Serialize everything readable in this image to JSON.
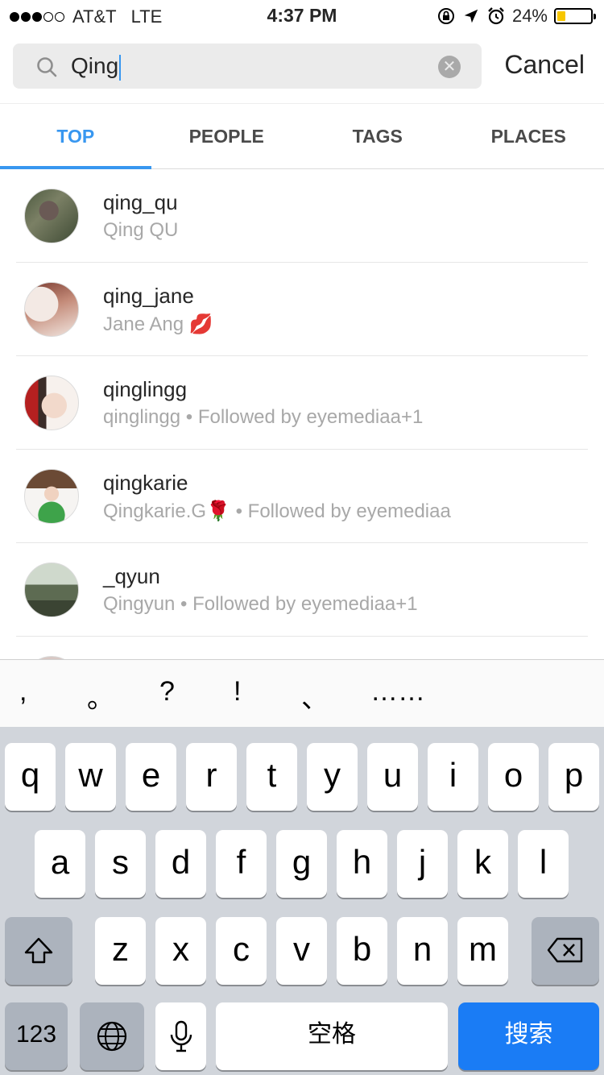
{
  "status_bar": {
    "carrier": "AT&T",
    "network": "LTE",
    "time": "4:37 PM",
    "battery": "24%",
    "battery_level": 0.24,
    "signal_bars_filled": 3,
    "signal_bars_total": 5
  },
  "search": {
    "value": "Qing",
    "cancel_label": "Cancel"
  },
  "tabs": [
    {
      "label": "TOP",
      "active": true
    },
    {
      "label": "PEOPLE",
      "active": false
    },
    {
      "label": "TAGS",
      "active": false
    },
    {
      "label": "PLACES",
      "active": false
    }
  ],
  "results": [
    {
      "username": "qing_qu",
      "subtitle": "Qing QU"
    },
    {
      "username": "qing_jane",
      "subtitle": "Jane Ang 💋"
    },
    {
      "username": "qinglingg",
      "subtitle": "qinglingg • Followed by eyemediaa+1"
    },
    {
      "username": "qingkarie",
      "subtitle": "Qingkarie.G🌹 • Followed by eyemediaa"
    },
    {
      "username": "_qyun",
      "subtitle": "Qingyun • Followed by eyemediaa+1"
    }
  ],
  "candidates": [
    ",",
    "。",
    "?",
    "!",
    "、",
    "……"
  ],
  "keyboard": {
    "row1": [
      "q",
      "w",
      "e",
      "r",
      "t",
      "y",
      "u",
      "i",
      "o",
      "p"
    ],
    "row2": [
      "a",
      "s",
      "d",
      "f",
      "g",
      "h",
      "j",
      "k",
      "l"
    ],
    "row3": [
      "z",
      "x",
      "c",
      "v",
      "b",
      "n",
      "m"
    ],
    "numbers_label": "123",
    "space_label": "空格",
    "search_label": "搜索"
  },
  "colors": {
    "accent": "#3897f0",
    "search_key": "#1a7cf5",
    "battery_fill": "#f7c600"
  }
}
